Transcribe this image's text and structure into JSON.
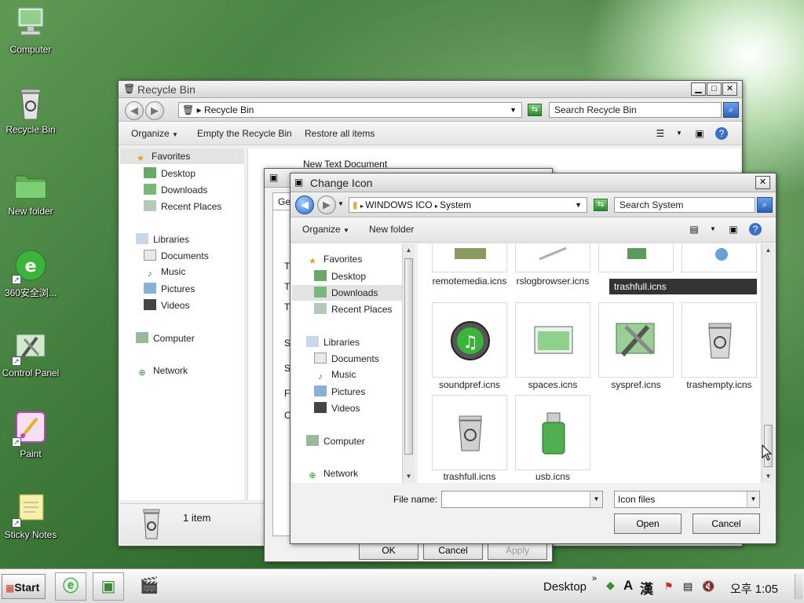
{
  "desktop": {
    "icons": [
      {
        "label": "Computer",
        "icon": "computer-icon"
      },
      {
        "label": "Recycle Bin",
        "icon": "recycle-bin-icon"
      },
      {
        "label": "New folder",
        "icon": "folder-icon"
      },
      {
        "label": "360安全浏...",
        "icon": "browser-360-icon"
      },
      {
        "label": "Control Panel",
        "icon": "control-panel-icon"
      },
      {
        "label": "Paint",
        "icon": "paint-icon"
      },
      {
        "label": "Sticky Notes",
        "icon": "sticky-notes-icon"
      }
    ]
  },
  "recycle_window": {
    "title": "Recycle Bin",
    "address": "Recycle Bin",
    "search_placeholder": "Search Recycle Bin",
    "toolbar": {
      "organize": "Organize",
      "empty": "Empty the Recycle Bin",
      "restore": "Restore all items"
    },
    "nav": {
      "favorites": "Favorites",
      "desktop": "Desktop",
      "downloads": "Downloads",
      "recent": "Recent Places",
      "libraries": "Libraries",
      "documents": "Documents",
      "music": "Music",
      "pictures": "Pictures",
      "videos": "Videos",
      "computer": "Computer",
      "network": "Network"
    },
    "file_partial": "New Text Document",
    "status": "1 item"
  },
  "props_window": {
    "tab_partial": "Ge",
    "row_letters": [
      "T",
      "T",
      "T",
      "S",
      "S",
      "F",
      "C"
    ],
    "ok": "OK",
    "cancel": "Cancel",
    "apply": "Apply"
  },
  "change_icon": {
    "title": "Change Icon",
    "path": [
      "WINDOWS ICO",
      "System"
    ],
    "search_placeholder": "Search System",
    "toolbar": {
      "organize": "Organize",
      "new_folder": "New folder"
    },
    "nav": {
      "favorites": "Favorites",
      "desktop": "Desktop",
      "downloads": "Downloads",
      "recent": "Recent Places",
      "libraries": "Libraries",
      "documents": "Documents",
      "music": "Music",
      "pictures": "Pictures",
      "videos": "Videos",
      "computer": "Computer",
      "network": "Network"
    },
    "top_row": [
      "remotemedia.icns",
      "rslogbrowser.icns"
    ],
    "tooltip": "trashfull.icns",
    "row2": [
      "soundpref.icns",
      "spaces.icns",
      "syspref.icns",
      "trashempty.icns"
    ],
    "row3": [
      "trashfull.icns",
      "usb.icns"
    ],
    "file_name_label": "File name:",
    "file_name_value": "",
    "file_type": "Icon files",
    "open": "Open",
    "cancel": "Cancel"
  },
  "taskbar": {
    "start": "Start",
    "desktop_label": "Desktop",
    "ime_a": "A",
    "ime_han": "漢",
    "clock": "오후 1:05"
  }
}
